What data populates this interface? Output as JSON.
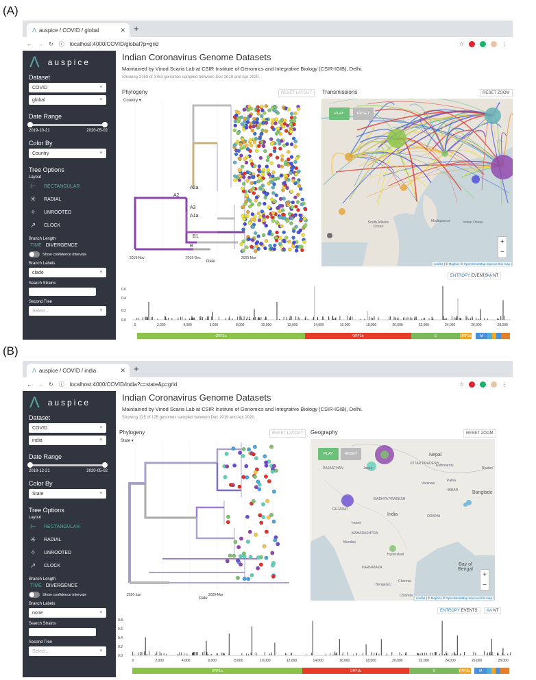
{
  "panels": [
    {
      "panel_label": "(A)",
      "browser": {
        "tab_title": "auspice / COVID / global",
        "url": "localhost:4000/COVID/global?p=grid"
      },
      "sidebar": {
        "logo_text": "auspice",
        "dataset_heading": "Dataset",
        "dataset_values": [
          "COVID",
          "global"
        ],
        "date_range_heading": "Date Range",
        "date_start": "2019-10-21",
        "date_end": "2020-05-02",
        "color_by_heading": "Color By",
        "color_by_value": "Country",
        "tree_options_heading": "Tree Options",
        "layout_label": "Layout",
        "layouts": [
          "RECTANGULAR",
          "RADIAL",
          "UNROOTED",
          "CLOCK"
        ],
        "branch_length_label": "Branch Length",
        "branch_length_options": [
          "TIME",
          "DIVERGENCE"
        ],
        "confidence_label": "Show confidence intervals",
        "branch_labels_label": "Branch Labels",
        "branch_labels_value": "clade",
        "search_strains_label": "Search Strains",
        "second_tree_label": "Second Tree",
        "second_tree_placeholder": "Select..."
      },
      "main": {
        "title": "Indian Coronavirus Genome Datasets",
        "maintainer": "Maintained by Vinod Scaria Lab at CSIR Institute of Genomics and Integrative Biology (CSIR-IGIB), Delhi.",
        "showing": "Showing 3763 of 3763 genomes sampled between Dec 2019 and Apr 2020.",
        "phylogeny_title": "Phylogeny",
        "reset_layout": "RESET LAYOUT",
        "tree_color_dropdown": "Country",
        "clade_labels": [
          "A2a",
          "A2",
          "A3",
          "A1a",
          "B1",
          "B"
        ],
        "time_ticks": [
          "2019-Nov",
          "2019-Dec",
          "2020-Mar"
        ],
        "x_axis_label": "Date",
        "map_title": "Transmissions",
        "reset_zoom": "RESET ZOOM",
        "play": "PLAY",
        "reset": "RESET",
        "map_labels": [
          "South Atlantic Ocean",
          "Indian Ocean",
          "Madagascar"
        ],
        "attribution": {
          "leaflet": "Leaflet",
          "mapbox": "Mapbox",
          "osm": "OpenStreetMap",
          "improve": "Improve this map"
        },
        "entropy_buttons": [
          "ENTROPY",
          "EVENTS",
          "AA",
          "NT"
        ],
        "y_ticks": [
          "0.6",
          "0.4",
          "0.2",
          "0.0"
        ],
        "x_ticks": [
          "0",
          "2,000",
          "4,000",
          "6,000",
          "8,000",
          "10,000",
          "12,000",
          "14,000",
          "16,000",
          "18,000",
          "20,000",
          "22,000",
          "24,000",
          "26,000",
          "28,000"
        ],
        "genes": [
          "ORF1a",
          "ORF1b",
          "S",
          "ORF3a",
          "M"
        ]
      }
    },
    {
      "panel_label": "(B)",
      "browser": {
        "tab_title": "auspice / COVID / india",
        "url": "localhost:4000/COVID/india?c=state&p=grid"
      },
      "sidebar": {
        "logo_text": "auspice",
        "dataset_heading": "Dataset",
        "dataset_values": [
          "COVID",
          "india"
        ],
        "date_range_heading": "Date Range",
        "date_start": "2019-12-21",
        "date_end": "2020-05-02",
        "color_by_heading": "Color By",
        "color_by_value": "State",
        "tree_options_heading": "Tree Options",
        "layout_label": "Layout",
        "layouts": [
          "RECTANGULAR",
          "RADIAL",
          "UNROOTED",
          "CLOCK"
        ],
        "branch_length_label": "Branch Length",
        "branch_length_options": [
          "TIME",
          "DIVERGENCE"
        ],
        "confidence_label": "Show confidence intervals",
        "branch_labels_label": "Branch Labels",
        "branch_labels_value": "none",
        "search_strains_label": "Search Strains",
        "second_tree_label": "Second Tree",
        "second_tree_placeholder": "Select..."
      },
      "main": {
        "title": "Indian Coronavirus Genome Datasets",
        "maintainer": "Maintained by Vinod Scaria Lab at CSIR Institute of Genomics and Integrative Biology (CSIR-IGIB), Delhi.",
        "showing": "Showing 125 of 125 genomes sampled between Dec 2019 and Apr 2020.",
        "phylogeny_title": "Phylogeny",
        "reset_layout": "RESET LAYOUT",
        "tree_color_dropdown": "State",
        "time_ticks": [
          "2020-Jan",
          "2020-Mar"
        ],
        "x_axis_label": "Date",
        "map_title": "Geography",
        "reset_zoom": "RESET ZOOM",
        "play": "PLAY",
        "reset": "RESET",
        "map_labels": [
          "Nepal",
          "India",
          "Banglade",
          "Bay of Bengal",
          "Hyderabad",
          "Mumbai",
          "Jaipur",
          "Varanasi",
          "Patna",
          "Indore",
          "Chennai",
          "Bengaluru",
          "Colombo",
          "RAJASTHAN",
          "MAHARASHTRA",
          "KARNATAKA",
          "GUJARAT",
          "MADHYA PRADESH",
          "UTTAR PRADESH",
          "ODISHA",
          "BIHAR",
          "Kathmandu",
          "Bhutan"
        ],
        "attribution": {
          "leaflet": "Leaflet",
          "mapbox": "Mapbox",
          "osm": "OpenStreetMap",
          "improve": "Improve this map"
        },
        "entropy_buttons": [
          "ENTROPY",
          "EVENTS",
          "AA",
          "NT"
        ],
        "y_ticks": [
          "0.8",
          "0.6",
          "0.4",
          "0.2",
          "0.0"
        ],
        "x_ticks": [
          "0",
          "2,000",
          "4,000",
          "6,000",
          "8,000",
          "10,000",
          "12,000",
          "14,000",
          "16,000",
          "18,000",
          "20,000",
          "22,000",
          "24,000",
          "26,000",
          "28,000"
        ],
        "genes": [
          "ORF1a",
          "ORF1b",
          "S",
          "ORF3a",
          "M"
        ]
      }
    }
  ],
  "colors": {
    "teal": "#5da8a3",
    "sidebar": "#30353f",
    "orf1a": "#8bc34a",
    "orf1b": "#e53d2a",
    "s": "#7cb85c",
    "orf3a": "#f5a623",
    "m": "#4a90d9"
  }
}
